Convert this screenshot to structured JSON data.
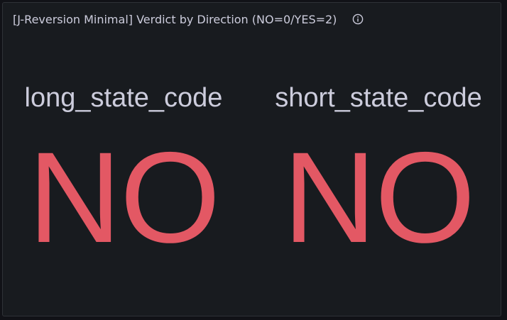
{
  "panel": {
    "title": "[J-Reversion Minimal] Verdict by Direction (NO=0/YES=2)",
    "info_icon": "info-circle-icon"
  },
  "stats": [
    {
      "name": "long_state_code",
      "value": "NO",
      "color": "#e35864"
    },
    {
      "name": "short_state_code",
      "value": "NO",
      "color": "#e35864"
    }
  ],
  "colors": {
    "background": "#111217",
    "panel": "#181b1f",
    "text": "#ccccdc",
    "value_red": "#e35864"
  }
}
